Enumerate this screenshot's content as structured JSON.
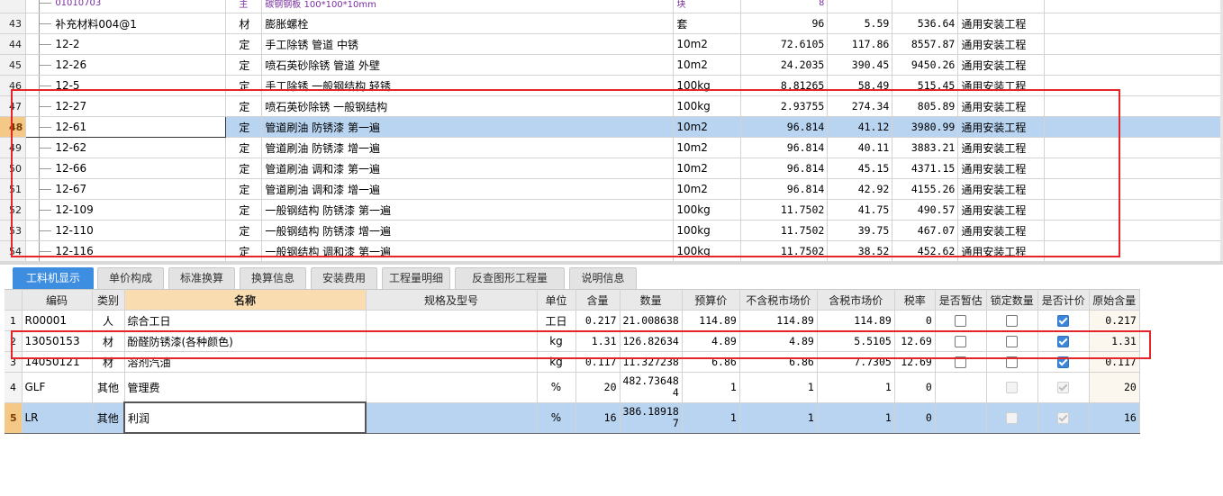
{
  "upper_rows": [
    {
      "rownum": "",
      "code": "01010703",
      "type": "主",
      "name": "碳钢钢板 100*100*10mm",
      "unit": "块",
      "qty": "8",
      "price": "",
      "total": "",
      "specialty": "",
      "partial": true
    },
    {
      "rownum": "43",
      "code": "补充材料004@1",
      "type": "材",
      "name": "膨胀螺栓",
      "unit": "套",
      "qty": "96",
      "price": "5.59",
      "total": "536.64",
      "specialty": "通用安装工程"
    },
    {
      "rownum": "44",
      "code": "12-2",
      "type": "定",
      "name": "手工除锈 管道 中锈",
      "unit": "10m2",
      "qty": "72.6105",
      "price": "117.86",
      "total": "8557.87",
      "specialty": "通用安装工程"
    },
    {
      "rownum": "45",
      "code": "12-26",
      "type": "定",
      "name": "喷石英砂除锈 管道 外壁",
      "unit": "10m2",
      "qty": "24.2035",
      "price": "390.45",
      "total": "9450.26",
      "specialty": "通用安装工程"
    },
    {
      "rownum": "46",
      "code": "12-5",
      "type": "定",
      "name": "手工除锈 一般钢结构 轻锈",
      "unit": "100kg",
      "qty": "8.81265",
      "price": "58.49",
      "total": "515.45",
      "specialty": "通用安装工程"
    },
    {
      "rownum": "47",
      "code": "12-27",
      "type": "定",
      "name": "喷石英砂除锈 一般钢结构",
      "unit": "100kg",
      "qty": "2.93755",
      "price": "274.34",
      "total": "805.89",
      "specialty": "通用安装工程"
    },
    {
      "rownum": "48",
      "code": "12-61",
      "type": "定",
      "name": "管道刷油 防锈漆 第一遍",
      "unit": "10m2",
      "qty": "96.814",
      "price": "41.12",
      "total": "3980.99",
      "specialty": "通用安装工程",
      "selected": true
    },
    {
      "rownum": "49",
      "code": "12-62",
      "type": "定",
      "name": "管道刷油 防锈漆 增一遍",
      "unit": "10m2",
      "qty": "96.814",
      "price": "40.11",
      "total": "3883.21",
      "specialty": "通用安装工程"
    },
    {
      "rownum": "50",
      "code": "12-66",
      "type": "定",
      "name": "管道刷油 调和漆 第一遍",
      "unit": "10m2",
      "qty": "96.814",
      "price": "45.15",
      "total": "4371.15",
      "specialty": "通用安装工程"
    },
    {
      "rownum": "51",
      "code": "12-67",
      "type": "定",
      "name": "管道刷油 调和漆 增一遍",
      "unit": "10m2",
      "qty": "96.814",
      "price": "42.92",
      "total": "4155.26",
      "specialty": "通用安装工程"
    },
    {
      "rownum": "52",
      "code": "12-109",
      "type": "定",
      "name": "一般钢结构 防锈漆 第一遍",
      "unit": "100kg",
      "qty": "11.7502",
      "price": "41.75",
      "total": "490.57",
      "specialty": "通用安装工程"
    },
    {
      "rownum": "53",
      "code": "12-110",
      "type": "定",
      "name": "一般钢结构 防锈漆 增一遍",
      "unit": "100kg",
      "qty": "11.7502",
      "price": "39.75",
      "total": "467.07",
      "specialty": "通用安装工程"
    },
    {
      "rownum": "54",
      "code": "12-116",
      "type": "定",
      "name": "一般钢结构 调和漆 第一遍",
      "unit": "100kg",
      "qty": "11.7502",
      "price": "38.52",
      "total": "452.62",
      "specialty": "通用安装工程"
    }
  ],
  "tabs": [
    {
      "label": "工料机显示",
      "active": true
    },
    {
      "label": "单价构成"
    },
    {
      "label": "标准换算"
    },
    {
      "label": "换算信息"
    },
    {
      "label": "安装费用"
    },
    {
      "label": "工程量明细"
    },
    {
      "label": "反查图形工程量"
    },
    {
      "label": "说明信息"
    }
  ],
  "lower_headers": [
    "",
    "编码",
    "类别",
    "名称",
    "规格及型号",
    "单位",
    "含量",
    "数量",
    "预算价",
    "不含税市场价",
    "含税市场价",
    "税率",
    "是否暂估",
    "锁定数量",
    "是否计价",
    "原始含量"
  ],
  "lower_rows": [
    {
      "rownum": "1",
      "code": "R00001",
      "type": "人",
      "name": "综合工日",
      "spec": "",
      "unit": "工日",
      "content": "0.217",
      "qty": "21.008638",
      "budget": "114.89",
      "market_ex": "114.89",
      "market_in": "114.89",
      "tax": "0",
      "provisional": "off",
      "locked": "off",
      "priced": "on",
      "orig": "0.217"
    },
    {
      "rownum": "2",
      "code": "13050153",
      "type": "材",
      "name": "酚醛防锈漆(各种颜色)",
      "spec": "",
      "unit": "kg",
      "content": "1.31",
      "qty": "126.82634",
      "budget": "4.89",
      "market_ex": "4.89",
      "market_in": "5.5105",
      "tax": "12.69",
      "provisional": "off",
      "locked": "off",
      "priced": "on",
      "orig": "1.31"
    },
    {
      "rownum": "3",
      "code": "14050121",
      "type": "材",
      "name": "溶剂汽油",
      "spec": "",
      "unit": "kg",
      "content": "0.117",
      "qty": "11.327238",
      "budget": "6.86",
      "market_ex": "6.86",
      "market_in": "7.7305",
      "tax": "12.69",
      "provisional": "off",
      "locked": "off",
      "priced": "on",
      "orig": "0.117"
    },
    {
      "rownum": "4",
      "code": "GLF",
      "type": "其他",
      "name": "管理费",
      "spec": "",
      "unit": "%",
      "content": "20",
      "qty": "482.736484",
      "budget": "1",
      "market_ex": "1",
      "market_in": "1",
      "tax": "0",
      "provisional": "none",
      "locked": "dis",
      "priced": "dis-on",
      "orig": "20",
      "tall": true
    },
    {
      "rownum": "5",
      "code": "LR",
      "type": "其他",
      "name": "利润",
      "spec": "",
      "unit": "%",
      "content": "16",
      "qty": "386.189187",
      "budget": "1",
      "market_ex": "1",
      "market_in": "1",
      "tax": "0",
      "provisional": "none",
      "locked": "dis",
      "priced": "dis-on",
      "orig": "16",
      "tall": true,
      "selected": true
    }
  ]
}
